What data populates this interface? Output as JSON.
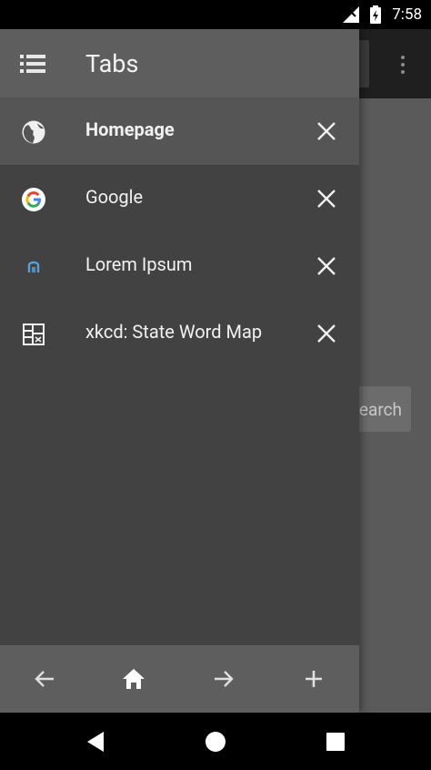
{
  "status_bar": {
    "time": "7:58"
  },
  "background_page": {
    "search_label": "earch"
  },
  "drawer": {
    "title": "Tabs",
    "tabs": [
      {
        "title": "Homepage",
        "icon": "globe-icon",
        "active": true
      },
      {
        "title": "Google",
        "icon": "google-icon",
        "active": false
      },
      {
        "title": "Lorem Ipsum",
        "icon": "lorem-ipsum-icon",
        "active": false
      },
      {
        "title": "xkcd: State Word Map",
        "icon": "xkcd-icon",
        "active": false
      }
    ],
    "footer_buttons": [
      "back-arrow-icon",
      "home-icon",
      "forward-arrow-icon",
      "add-icon"
    ]
  },
  "colors": {
    "status_bar": "#000000",
    "drawer_header": "#5e5e5e",
    "drawer_body": "#424242",
    "active_tab": "#555555",
    "page_background": "#5a5a5a"
  }
}
